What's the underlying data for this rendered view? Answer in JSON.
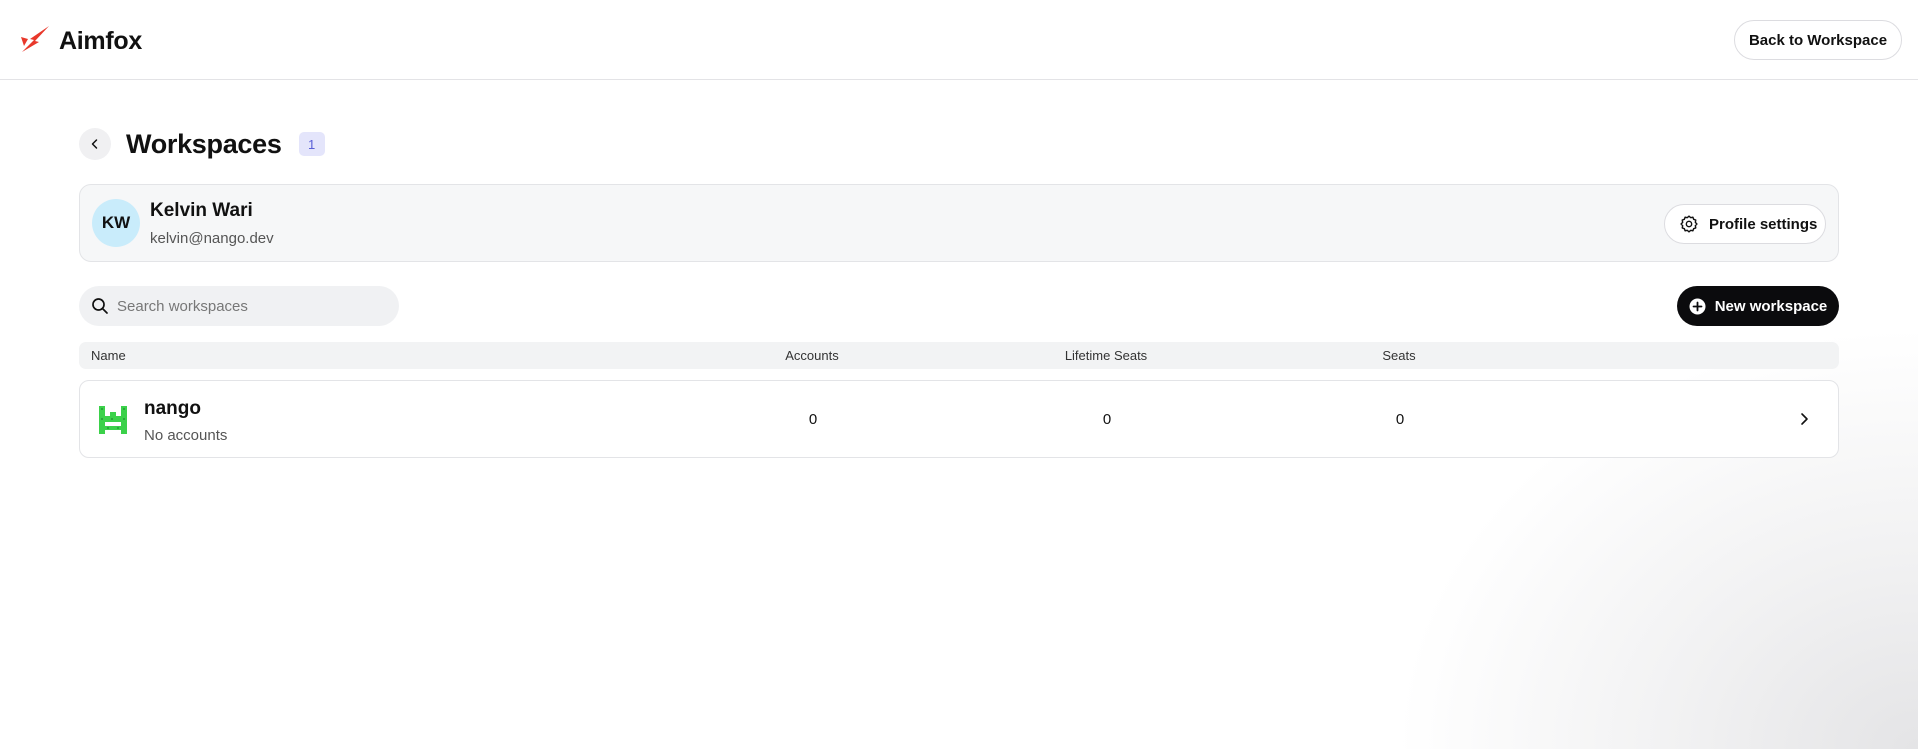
{
  "app": {
    "name": "Aimfox",
    "logo_icon": "aimfox-logo-icon",
    "brand_color": "#e8382b"
  },
  "header": {
    "back_to_workspace_label": "Back to Workspace"
  },
  "page": {
    "title": "Workspaces",
    "count": "1"
  },
  "profile": {
    "initials": "KW",
    "name": "Kelvin Wari",
    "email": "kelvin@nango.dev",
    "settings_label": "Profile settings",
    "avatar_color": "#c9ecfb"
  },
  "search": {
    "placeholder": "Search workspaces",
    "value": ""
  },
  "actions": {
    "new_workspace_label": "New workspace"
  },
  "table": {
    "columns": [
      "Name",
      "Accounts",
      "Lifetime Seats",
      "Seats"
    ],
    "rows": [
      {
        "name": "nango",
        "subtitle": "No accounts",
        "accounts": "0",
        "lifetime_seats": "0",
        "seats": "0",
        "logo_color": "#3bd14a"
      }
    ]
  }
}
